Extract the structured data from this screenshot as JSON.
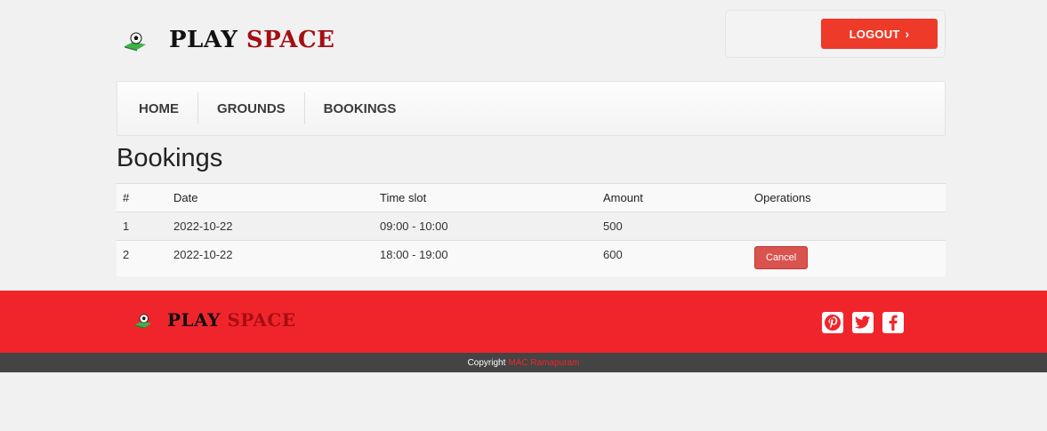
{
  "brand": {
    "word1": "PLAY",
    "word2": "SPACE"
  },
  "header": {
    "logout_label": "LOGOUT"
  },
  "nav": {
    "items": [
      {
        "label": "HOME"
      },
      {
        "label": "GROUNDS"
      },
      {
        "label": "BOOKINGS"
      }
    ]
  },
  "page": {
    "title": "Bookings"
  },
  "table": {
    "columns": [
      "#",
      "Date",
      "Time slot",
      "Amount",
      "Operations"
    ],
    "rows": [
      {
        "num": "1",
        "date": "2022-10-22",
        "slot": "09:00 - 10:00",
        "amount": "500",
        "operation": ""
      },
      {
        "num": "2",
        "date": "2022-10-22",
        "slot": "18:00 - 19:00",
        "amount": "600",
        "operation": "Cancel"
      }
    ]
  },
  "footer": {
    "social_icons": [
      "pinterest-icon",
      "twitter-icon",
      "facebook-icon"
    ],
    "copyright_label": "Copyright",
    "copyright_link": "MAC Ramapuram"
  },
  "colors": {
    "accent": "#f0252c",
    "button": "#ee3a29",
    "cancel": "#d9534f",
    "brand_dark_red": "#a30f14"
  }
}
